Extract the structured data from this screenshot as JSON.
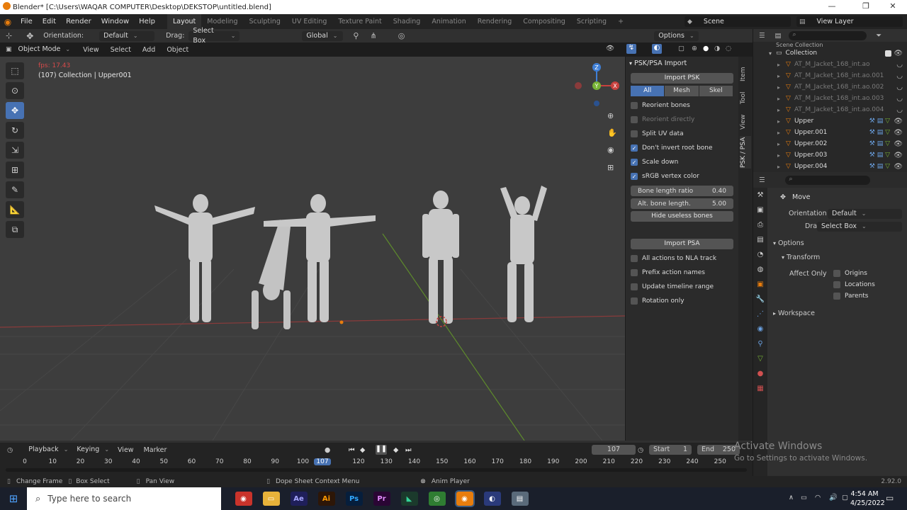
{
  "window": {
    "title": "Blender* [C:\\Users\\WAQAR COMPUTER\\Desktop\\DEKSTOP\\untitled.blend]",
    "minimize": "—",
    "maximize": "❐",
    "close": "✕"
  },
  "menu": {
    "items": [
      "File",
      "Edit",
      "Render",
      "Window",
      "Help"
    ],
    "workspaces": [
      "Layout",
      "Modeling",
      "Sculpting",
      "UV Editing",
      "Texture Paint",
      "Shading",
      "Animation",
      "Rendering",
      "Compositing",
      "Scripting"
    ],
    "add_tab": "+",
    "scene": "Scene",
    "view_layer": "View Layer"
  },
  "tool_header": {
    "orientation_label": "Orientation:",
    "orientation_value": "Default",
    "drag_label": "Drag:",
    "drag_value": "Select Box",
    "transform": "Global",
    "options": "Options"
  },
  "viewport_header": {
    "mode": "Object Mode",
    "menus": [
      "View",
      "Select",
      "Add",
      "Object"
    ]
  },
  "viewport": {
    "fps": "fps: 17.43",
    "info": "(107) Collection | Upper001"
  },
  "gizmo": {
    "x": "X",
    "y": "Y",
    "z": "Z"
  },
  "npanel": {
    "title": "PSK/PSA Import",
    "import_psk": "Import PSK",
    "segments": [
      "All",
      "Mesh",
      "Skel"
    ],
    "checks1": [
      {
        "label": "Reorient bones",
        "checked": false,
        "dim": false
      },
      {
        "label": "Reorient directly",
        "checked": false,
        "dim": true
      },
      {
        "label": "Split UV data",
        "checked": false,
        "dim": false
      },
      {
        "label": "Don't invert root bone",
        "checked": true,
        "dim": false
      },
      {
        "label": "Scale down",
        "checked": true,
        "dim": false
      },
      {
        "label": "sRGB vertex color",
        "checked": true,
        "dim": false
      }
    ],
    "bone_length_ratio_label": "Bone length ratio",
    "bone_length_ratio_value": "0.40",
    "alt_bone_label": "Alt. bone length.",
    "alt_bone_value": "5.00",
    "hide_useless": "Hide useless bones",
    "import_psa": "Import PSA",
    "checks2": [
      "All actions to NLA track",
      "Prefix action names",
      "Update timeline range",
      "Rotation only"
    ]
  },
  "side_tabs": [
    "Item",
    "Tool",
    "View",
    "PSK / PSA"
  ],
  "outliner": {
    "scene_collection": "Scene Collection",
    "collection": "Collection",
    "items": [
      {
        "name": "AT_M_Jacket_168_int.ao",
        "dim": true
      },
      {
        "name": "AT_M_Jacket_168_int.ao.001",
        "dim": true
      },
      {
        "name": "AT_M_Jacket_168_int.ao.002",
        "dim": true
      },
      {
        "name": "AT_M_Jacket_168_int.ao.003",
        "dim": true
      },
      {
        "name": "AT_M_Jacket_168_int.ao.004",
        "dim": true
      },
      {
        "name": "Upper",
        "dim": false
      },
      {
        "name": "Upper.001",
        "dim": false
      },
      {
        "name": "Upper.002",
        "dim": false
      },
      {
        "name": "Upper.003",
        "dim": false
      },
      {
        "name": "Upper.004",
        "dim": false
      }
    ]
  },
  "properties": {
    "tool": "Move",
    "orientation_label": "Orientation",
    "orientation_value": "Default",
    "drag_label": "Drag:",
    "drag_value": "Select Box",
    "options": "Options",
    "transform": "Transform",
    "affect_only": "Affect Only",
    "affect_items": [
      "Origins",
      "Locations",
      "Parents"
    ],
    "workspace": "Workspace"
  },
  "timeline": {
    "menus": [
      "Playback",
      "Keying",
      "View",
      "Marker"
    ],
    "current_frame": "107",
    "start_label": "Start",
    "start": "1",
    "end_label": "End",
    "end": "250",
    "ruler": [
      "0",
      "10",
      "20",
      "30",
      "40",
      "50",
      "60",
      "70",
      "80",
      "90",
      "100",
      "107",
      "120",
      "130",
      "140",
      "150",
      "160",
      "170",
      "180",
      "190",
      "200",
      "210",
      "220",
      "230",
      "240",
      "250"
    ]
  },
  "activate": {
    "line1": "Activate Windows",
    "line2": "Go to Settings to activate Windows."
  },
  "statusbar": {
    "change_frame": "Change Frame",
    "box_select": "Box Select",
    "pan_view": "Pan View",
    "context_menu": "Dope Sheet Context Menu",
    "anim_player": "Anim Player",
    "version": "2.92.0"
  },
  "taskbar": {
    "search_placeholder": "Type here to search",
    "time": "4:54 AM",
    "date": "4/25/2022",
    "apps": [
      "Ae",
      "Ai",
      "Ps",
      "Pr"
    ]
  },
  "colors": {
    "accent": "#4772b3",
    "fps_red": "#d64a4a",
    "x_axis": "#c9413e",
    "y_axis": "#78b336",
    "z_axis": "#3f7fd6"
  }
}
